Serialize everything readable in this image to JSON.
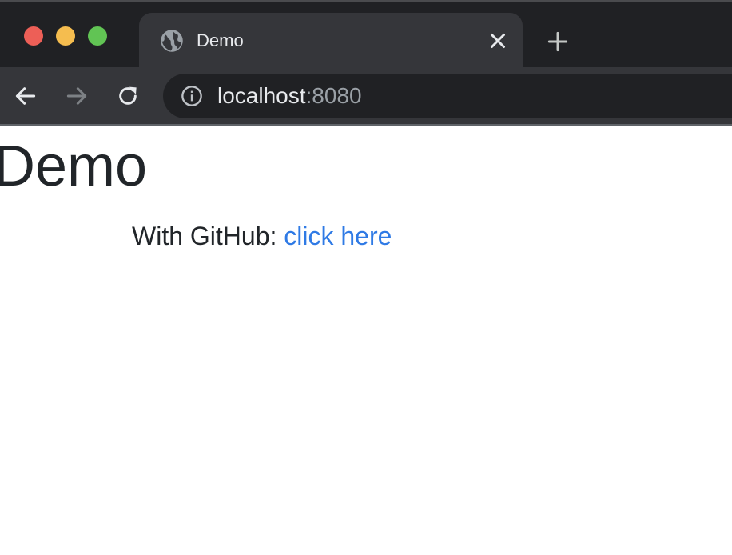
{
  "window": {
    "buttons": [
      "close",
      "minimize",
      "maximize"
    ],
    "colors": {
      "close": "#ed5f57",
      "minimize": "#f5bd4f",
      "maximize": "#61c454"
    }
  },
  "tab": {
    "title": "Demo",
    "favicon": "globe-icon",
    "close_icon": "close-icon"
  },
  "new_tab_icon": "plus-icon",
  "toolbar": {
    "back_icon": "arrow-left-icon",
    "forward_icon": "arrow-right-icon",
    "reload_icon": "reload-icon",
    "info_icon": "info-icon",
    "url_host": "localhost",
    "url_port": ":8080"
  },
  "page": {
    "heading": "Demo",
    "login_prefix": "With GitHub: ",
    "login_link": "click here",
    "link_color": "#2f7ae5",
    "text_color": "#212529"
  },
  "theme": {
    "tabstrip_bg": "#202124",
    "toolbar_bg": "#35363a",
    "omnibox_bg": "#202124"
  }
}
